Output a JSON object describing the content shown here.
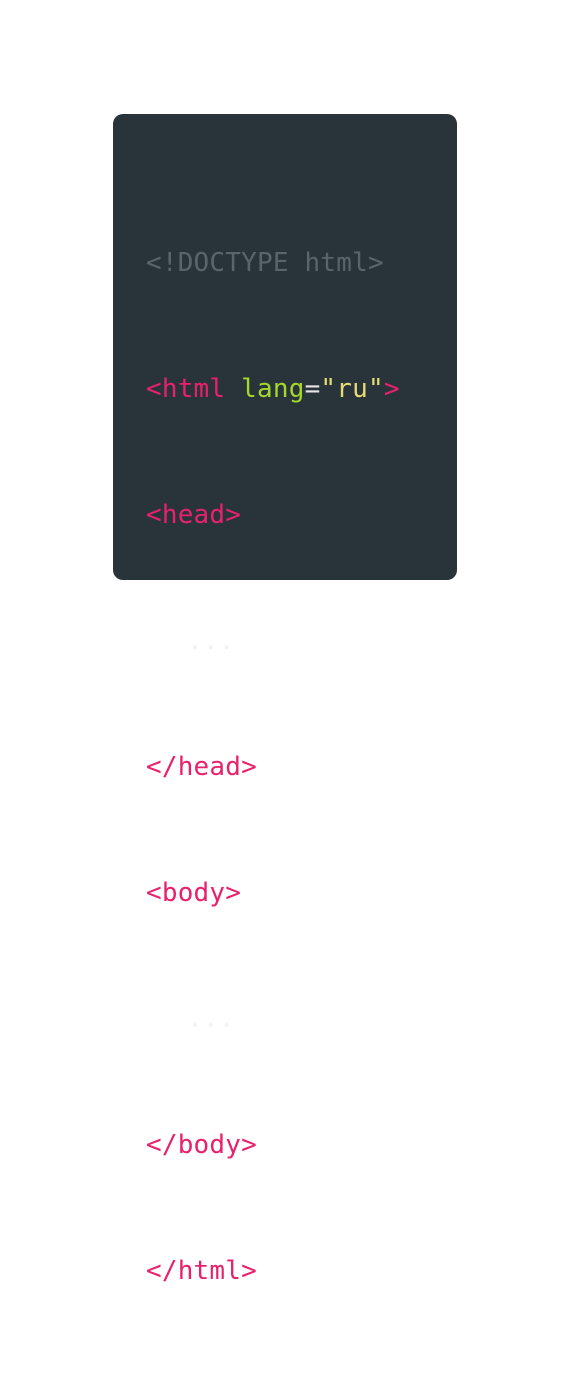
{
  "code": {
    "doctype": "<!DOCTYPE html>",
    "html_open_start": "<html",
    "html_open_space": " ",
    "attr_name": "lang",
    "attr_eq": "=",
    "attr_value": "\"ru\"",
    "html_open_end": ">",
    "head_open": "<head>",
    "head_content": "...",
    "head_close": "</head>",
    "body_open": "<body>",
    "body_content": "...",
    "body_close": "</body>",
    "html_close": "</html>"
  },
  "colors": {
    "background": "#ffffff",
    "card": "#29333a",
    "doctype": "#5a646b",
    "tag": "#e8216d",
    "attribute": "#a5d62c",
    "value": "#e6db74",
    "text": "#f2f2f2"
  }
}
